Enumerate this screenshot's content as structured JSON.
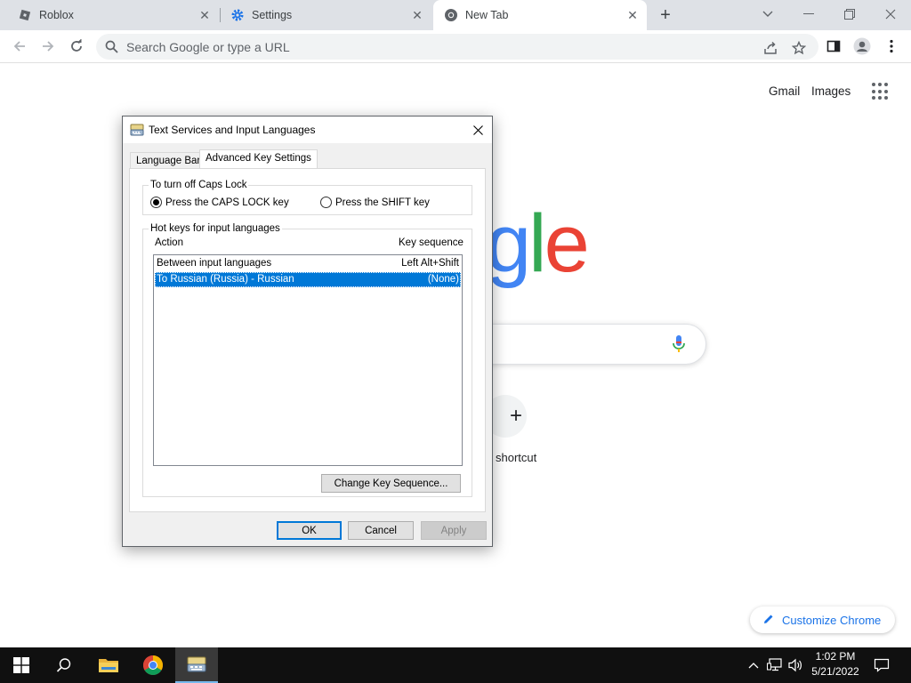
{
  "browser": {
    "tabs": [
      {
        "title": "Roblox",
        "icon": "roblox-icon",
        "active": false
      },
      {
        "title": "Settings",
        "icon": "gear-icon",
        "active": false
      },
      {
        "title": "New Tab",
        "icon": "chrome-icon",
        "active": true
      }
    ],
    "omnibox_placeholder": "Search Google or type a URL"
  },
  "newtab": {
    "links": [
      "Gmail",
      "Images"
    ],
    "logo_fragment": [
      "g",
      "l",
      "e"
    ],
    "logo_colors": [
      "#4285f4",
      "#34a853",
      "#ea4335"
    ],
    "shortcut_label": "shortcut",
    "customize_label": "Customize Chrome"
  },
  "dialog": {
    "title": "Text Services and Input Languages",
    "tabs": [
      "Language Bar",
      "Advanced Key Settings"
    ],
    "active_tab": "Advanced Key Settings",
    "caps_group": {
      "legend": "To turn off Caps Lock",
      "options": [
        "Press the CAPS LOCK key",
        "Press the SHIFT key"
      ],
      "selected": "Press the CAPS LOCK key"
    },
    "hotkeys_group": {
      "legend": "Hot keys for input languages",
      "col_action": "Action",
      "col_sequence": "Key sequence",
      "rows": [
        {
          "action": "Between input languages",
          "sequence": "Left Alt+Shift",
          "selected": false
        },
        {
          "action": "To Russian (Russia) - Russian",
          "sequence": "(None)",
          "selected": true
        }
      ],
      "change_button": "Change Key Sequence..."
    },
    "buttons": {
      "ok": "OK",
      "cancel": "Cancel",
      "apply": "Apply"
    }
  },
  "taskbar": {
    "time": "1:02 PM",
    "date": "5/21/2022",
    "accent": "#0078d7"
  }
}
